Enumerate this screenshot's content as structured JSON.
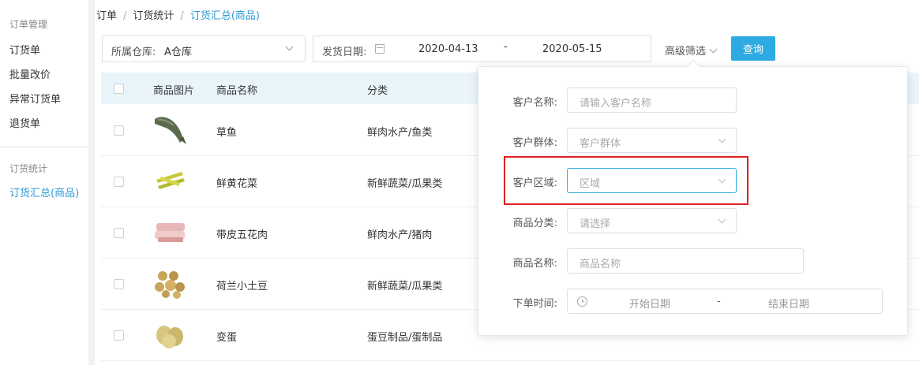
{
  "sidebar": {
    "group1_title": "订单管理",
    "items1": [
      "订货单",
      "批量改价",
      "异常订货单",
      "退货单"
    ],
    "group2_title": "订货统计",
    "active_item": "订货汇总(商品)"
  },
  "breadcrumb": [
    "订单",
    "订货统计",
    "订货汇总(商品)"
  ],
  "filters": {
    "warehouse_label": "所属仓库:",
    "warehouse_value": "A仓库",
    "ship_date_label": "发货日期:",
    "date_start": "2020-04-13",
    "date_sep": "-",
    "date_end": "2020-05-15",
    "advanced_label": "高级筛选",
    "query_label": "查询"
  },
  "table": {
    "headers": [
      "商品图片",
      "商品名称",
      "分类"
    ],
    "rows": [
      {
        "name": "草鱼",
        "category": "鲜肉水产/鱼类"
      },
      {
        "name": "鲜黄花菜",
        "category": "新鲜蔬菜/瓜果类"
      },
      {
        "name": "带皮五花肉",
        "category": "鲜肉水产/猪肉"
      },
      {
        "name": "荷兰小土豆",
        "category": "新鲜蔬菜/瓜果类"
      },
      {
        "name": "变蛋",
        "category": "蛋豆制品/蛋制品"
      }
    ]
  },
  "popover": {
    "customer_name_label": "客户名称:",
    "customer_name_placeholder": "请输入客户名称",
    "customer_group_label": "客户群体:",
    "customer_group_placeholder": "客户群体",
    "customer_region_label": "客户区域:",
    "customer_region_placeholder": "区域",
    "product_category_label": "商品分类:",
    "product_category_placeholder": "请选择",
    "product_name_label": "商品名称:",
    "product_name_placeholder": "商品名称",
    "order_time_label": "下单时间:",
    "start_date_placeholder": "开始日期",
    "date_sep": "-",
    "end_date_placeholder": "结束日期"
  },
  "colors": {
    "accent": "#2daae1",
    "highlight": "#e02020"
  }
}
